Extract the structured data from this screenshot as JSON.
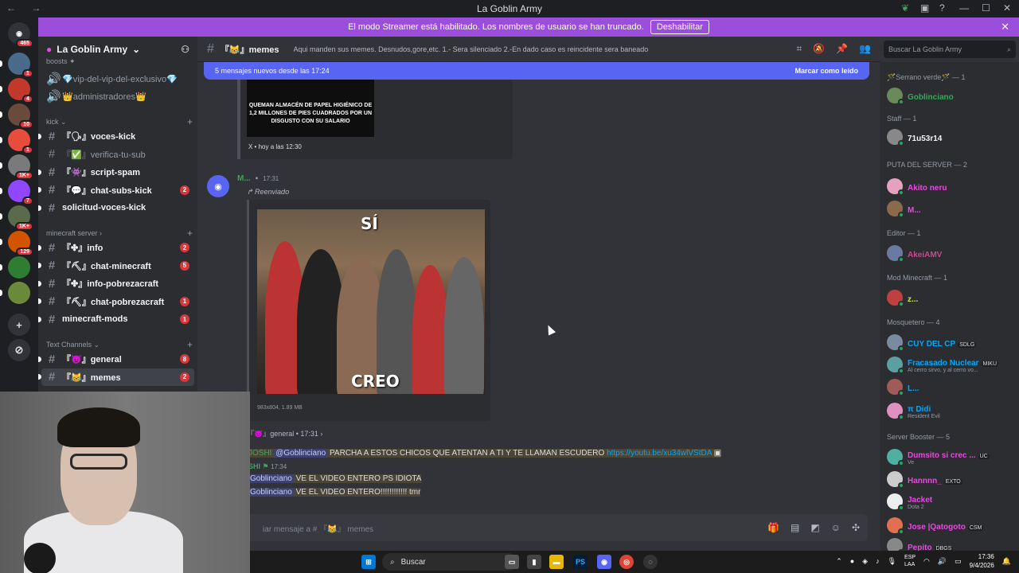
{
  "window": {
    "title": "La Goblin Army",
    "nav": "← →"
  },
  "banner": {
    "text": "El modo Streamer está habilitado. Los nombres de usuario se han truncado.",
    "button": "Deshabilitar"
  },
  "servers": {
    "top_badge": "465",
    "items": [
      {
        "badge": "1",
        "color": "#4a6a8a"
      },
      {
        "badge": "4",
        "color": "#c0392b"
      },
      {
        "badge": "10",
        "color": "#6a4a3a"
      },
      {
        "badge": "1",
        "color": "#e74c3c"
      },
      {
        "badge": "1K+",
        "color": "#7a7a7a"
      },
      {
        "badge": "7",
        "color": "#9146ff"
      },
      {
        "badge": "1K+",
        "color": "#5a6a4a"
      },
      {
        "badge": "129",
        "color": "#d35400"
      },
      {
        "badge": "",
        "color": "#2e7d32"
      },
      {
        "badge": "",
        "color": "#6a8a3a"
      }
    ]
  },
  "guild": {
    "name": "La Goblin Army"
  },
  "sidebar": {
    "cut_top": "boosts ✦",
    "channels_top": [
      {
        "label": "💎vip-del-vip-del-exclusivo💎"
      },
      {
        "label": "👑administradores👑"
      }
    ],
    "categories": [
      "kick",
      "minecraft server",
      "Text Channels"
    ],
    "kick": [
      {
        "label": "『🗣』voces-kick",
        "cnt": "",
        "unread": true
      },
      {
        "label": "『✅』verifica-tu-sub",
        "cnt": "",
        "unread": false
      },
      {
        "label": "『👾』script-spam",
        "cnt": "",
        "unread": true
      },
      {
        "label": "『💬』chat-subs-kick",
        "cnt": "2",
        "unread": true
      },
      {
        "label": "solicitud-voces-kick",
        "cnt": "",
        "unread": true
      }
    ],
    "minecraft": [
      {
        "label": "『✤』info",
        "cnt": "2"
      },
      {
        "label": "『⛏』chat-minecraft",
        "cnt": "5"
      },
      {
        "label": "『✤』info-pobrezacraft",
        "cnt": ""
      },
      {
        "label": "『⛏』chat-pobrezacraft",
        "cnt": "1"
      },
      {
        "label": "minecraft-mods",
        "cnt": "1"
      }
    ],
    "text": [
      {
        "label": "『😈』general",
        "cnt": "8"
      },
      {
        "label": "『😹』memes",
        "cnt": "2"
      }
    ]
  },
  "channel": {
    "name": "『😹』memes",
    "topic": "Aqui manden sus memes. Desnudos,gore,etc. 1.- Sera silenciado 2.-En dado caso es reincidente sera baneado"
  },
  "search": {
    "placeholder": "Buscar La Goblin Army"
  },
  "newbar": {
    "text": "5 mensajes nuevos desde las 17:24",
    "action": "Marcar como leído"
  },
  "embed": {
    "image_text": "QUEMAN ALMACÉN DE PAPEL HIGIÉNICO DE 1,2 MILLONES DE PIES CUADRADOS POR UN DISGUSTO CON SU SALARIO",
    "footer": "X • hoy a las 12:30"
  },
  "message": {
    "author": "M...",
    "time": "17:31",
    "forwarded": "↱ Reenviado",
    "meme_top": "SÍ",
    "meme_bottom": "CREO",
    "meta": "983x804, 1.89 MB",
    "origin": "『😈』general • 17:31 ›"
  },
  "lines": [
    {
      "prefix": "JOSHI",
      "mention": "@Goblinciano",
      "text": " PARCHA A ESTOS CHICOS QUE ATENTAN A TI Y TE LLAMAN ESCUDERO ",
      "link": "https://youtu.be/xu34wlVStDA"
    },
    {
      "prefix": "SHI",
      "time": "17:34"
    },
    {
      "mention": "Goblinciano",
      "text": " VE EL VIDEO ENTERO PS IDIOTA"
    },
    {
      "mention": "Goblinciano",
      "text": " VE EL VIDEO ENTERO!!!!!!!!!!!! tmr"
    }
  ],
  "composer": {
    "placeholder": "iar mensaje a # 『😹』 memes"
  },
  "members": {
    "roles": [
      {
        "name": "🪄Serrano verde🪄 — 1"
      },
      {
        "name": "Staff — 1"
      },
      {
        "name": "PUTA DEL SERVER — 2"
      },
      {
        "name": "Editor — 1"
      },
      {
        "name": "Mod Minecraft — 1"
      },
      {
        "name": "Mosquetero — 4"
      },
      {
        "name": "Server Booster — 5"
      }
    ],
    "list": [
      {
        "name": "Goblinciano",
        "color": "#3ba55c",
        "sub": "",
        "tag": ""
      },
      {
        "name": "71u53r14",
        "color": "#f2f3f5",
        "sub": "",
        "tag": ""
      },
      {
        "name": "Akito neru",
        "color": "#e64bde",
        "sub": "",
        "tag": ""
      },
      {
        "name": "M...",
        "color": "#e64bde",
        "sub": "",
        "tag": ""
      },
      {
        "name": "AkeiAMV",
        "color": "#c54a8a",
        "sub": "",
        "tag": ""
      },
      {
        "name": "z...",
        "color": "#d4e157",
        "sub": "",
        "tag": ""
      },
      {
        "name": "CUY DEL CP",
        "color": "#00a8fc",
        "sub": "",
        "tag": "SDLG"
      },
      {
        "name": "Fracasado Nuclear",
        "color": "#00a8fc",
        "sub": "Al cerro sirvo, y al cerro vo...",
        "tag": "MIKU"
      },
      {
        "name": "L...",
        "color": "#00a8fc",
        "sub": "",
        "tag": ""
      },
      {
        "name": "π Didi",
        "color": "#00a8fc",
        "sub": "Resident Evil",
        "tag": ""
      },
      {
        "name": "Dumsito si crec ...",
        "color": "#e64bde",
        "sub": "Ve",
        "tag": "UC"
      },
      {
        "name": "Hannnn_",
        "color": "#e64bde",
        "sub": "",
        "tag": "EXTO"
      },
      {
        "name": "Jacket",
        "color": "#e64bde",
        "sub": "Dota 2",
        "tag": ""
      },
      {
        "name": "Jose |Qatogoto",
        "color": "#e64bde",
        "sub": "",
        "tag": "CSM"
      },
      {
        "name": "Pepito",
        "color": "#e64bde",
        "sub": "",
        "tag": "DBGS"
      }
    ]
  },
  "taskbar": {
    "search": "Buscar",
    "apps": [
      "PS"
    ],
    "lang": "ESP\nLAA",
    "time": "17:36",
    "date": "9/4/2026"
  }
}
